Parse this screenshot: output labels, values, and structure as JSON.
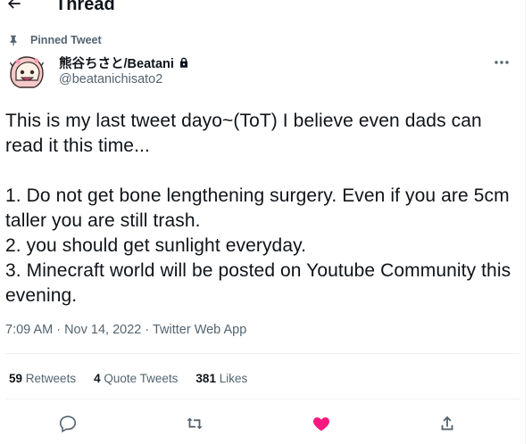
{
  "header": {
    "title": "Thread"
  },
  "pinned": {
    "label": "Pinned Tweet"
  },
  "author": {
    "name": "熊谷ちさと/Beatani",
    "handle": "@beatanichisato2"
  },
  "tweet": {
    "text": "This is my last tweet dayo~(ToT) I believe even dads can read it this time...\n\n1. Do not get bone lengthening surgery. Even if you are 5cm taller you are still trash.\n2. you should get sunlight everyday.\n3. Minecraft world will be posted on Youtube Community this evening.",
    "meta": "7:09 AM · Nov 14, 2022 · Twitter Web App"
  },
  "stats": {
    "retweets_count": "59",
    "retweets_label": "Retweets",
    "quotes_count": "4",
    "quotes_label": "Quote Tweets",
    "likes_count": "381",
    "likes_label": "Likes"
  },
  "icons": {
    "back": "back-arrow-icon",
    "pin": "pin-icon",
    "lock": "lock-icon",
    "more": "more-icon",
    "reply": "reply-icon",
    "retweet": "retweet-icon",
    "like": "heart-icon",
    "share": "share-icon"
  },
  "colors": {
    "like_active": "#f91880",
    "secondary_text": "#536471",
    "icon_gray": "#536471"
  }
}
